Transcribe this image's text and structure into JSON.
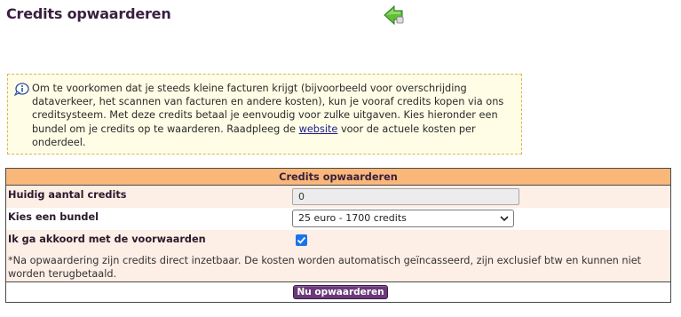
{
  "page": {
    "title": "Credits opwaarderen"
  },
  "info": {
    "text_before_link": "Om te voorkomen dat je steeds kleine facturen krijgt (bijvoorbeeld voor overschrijding dataverkeer, het scannen van facturen en andere kosten), kun je vooraf credits kopen via ons creditsysteem. Met deze credits betaal je eenvoudig voor zulke uitgaven. Kies hieronder een bundel om je credits op te waarderen. Raadpleeg de ",
    "link_text": "website",
    "text_after_link": " voor de actuele kosten per onderdeel."
  },
  "form": {
    "header": "Credits opwaarderen",
    "current_credits_label": "Huidig aantal credits",
    "current_credits_value": "0",
    "bundle_label": "Kies een bundel",
    "bundle_selected": "25 euro - 1700 credits",
    "agree_label": "Ik ga akkoord met de voorwaarden",
    "agree_checked": true,
    "note": "*Na opwaardering zijn credits direct inzetbaar. De kosten worden automatisch geïncasseerd, zijn exclusief btw en kunnen niet worden terugbetaald.",
    "submit_label": "Nu opwaarderen"
  },
  "icons": {
    "back": "back-arrow-icon",
    "info": "info-icon",
    "dropdown": "chevron-down-icon",
    "check": "checkmark-icon"
  },
  "colors": {
    "title": "#3a1f3f",
    "header_bg": "#f9b87a",
    "row_alt_bg": "#fdeee6",
    "info_bg": "#fffde6",
    "info_border": "#d8b94a",
    "button_bg": "#6a3a7a",
    "checkbox": "#1a73e8",
    "arrow_green": "#5fbf3a"
  }
}
